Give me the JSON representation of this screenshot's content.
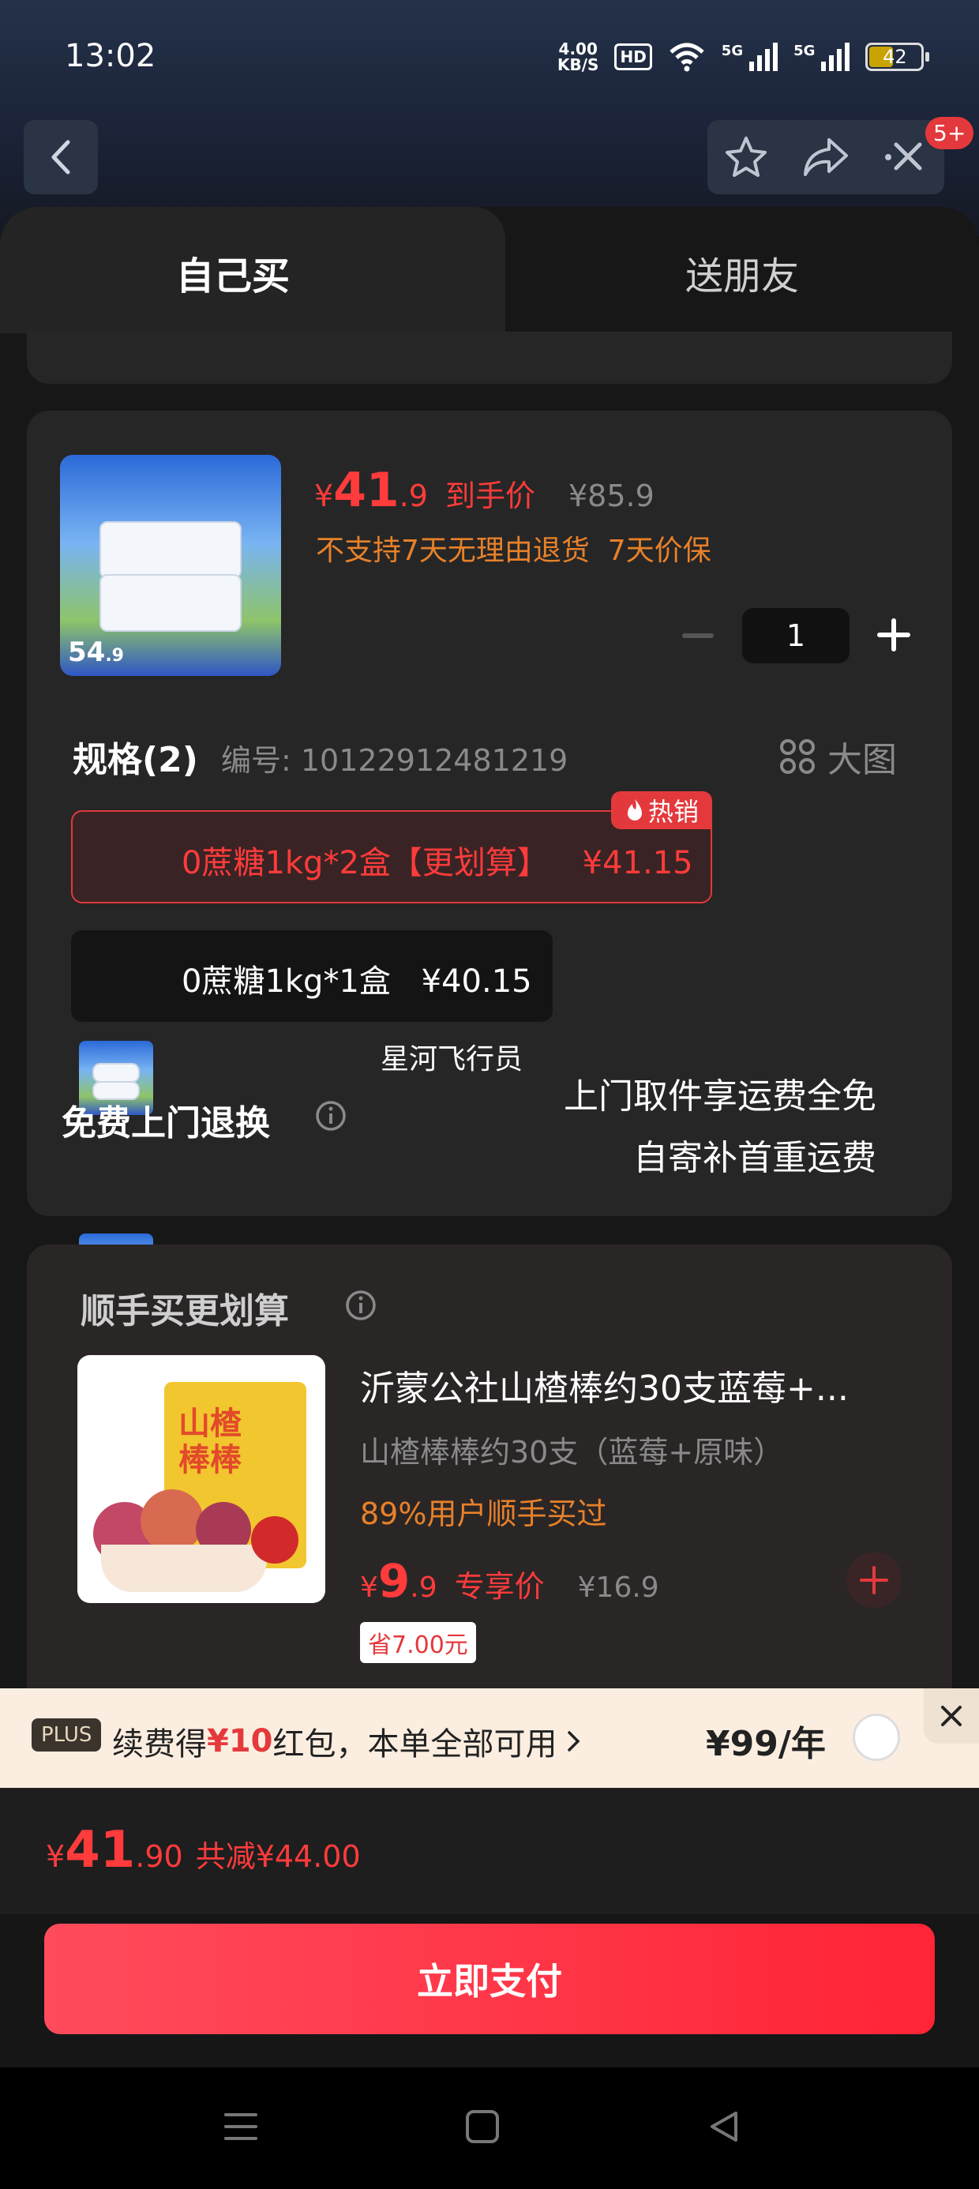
{
  "status_bar": {
    "time": "13:02",
    "net_speed_value": "4.00",
    "net_speed_unit": "KB/S",
    "hd_label": "HD",
    "signal_1_label": "5G",
    "signal_2_label": "5G",
    "battery_level": "42"
  },
  "header": {
    "notification_badge": "5+"
  },
  "tabs": {
    "self_buy": "自己买",
    "gift_friend": "送朋友"
  },
  "product": {
    "price_symbol": "¥",
    "price_int": "41",
    "price_dec": ".9",
    "price_label": "到手价",
    "original_price": "¥85.9",
    "policy_text": "不支持7天无理由退货  7天价保",
    "quantity": "1",
    "thumb_price_int": "54",
    "thumb_price_dec": ".9"
  },
  "spec": {
    "title": "规格(2)",
    "code_label": "编号: 10122912481219",
    "big_view_label": "大图",
    "hot_tag": "热销",
    "options": [
      {
        "name": "0蔗糖1kg*2盒【更划算】",
        "price": "¥41.15",
        "selected": true
      },
      {
        "name": "0蔗糖1kg*1盒",
        "price": "¥40.15",
        "selected": false
      }
    ]
  },
  "return_service": {
    "courier_label": "星河飞行员",
    "title": "免费上门退换",
    "desc_line1": "上门取件享运费全免",
    "desc_line2": "自寄补首重运费"
  },
  "addon": {
    "section_title": "顺手买更划算",
    "item_title": "沂蒙公社山楂棒约30支蓝莓+...",
    "item_subtitle": "山楂棒棒约30支（蓝莓+原味）",
    "buyers_note": "89%用户顺手买过",
    "price_symbol": "¥",
    "price_int": "9",
    "price_dec": ".9",
    "price_label": "专享价",
    "original_price": "¥16.9",
    "saving_tag": "省7.00元",
    "package_text": "山楂棒棒"
  },
  "plus": {
    "badge": "PLUS",
    "text_before": "续费得",
    "amount": "¥10",
    "text_after": "红包，本单全部可用",
    "price": "¥99/年"
  },
  "total": {
    "symbol": "¥",
    "int": "41",
    "dec": ".90",
    "discount": "共减¥44.00"
  },
  "pay_button": "立即支付",
  "colors": {
    "accent_red": "#ff3b3b",
    "orange": "#e8812a",
    "background": "#171717",
    "card": "#262626"
  }
}
